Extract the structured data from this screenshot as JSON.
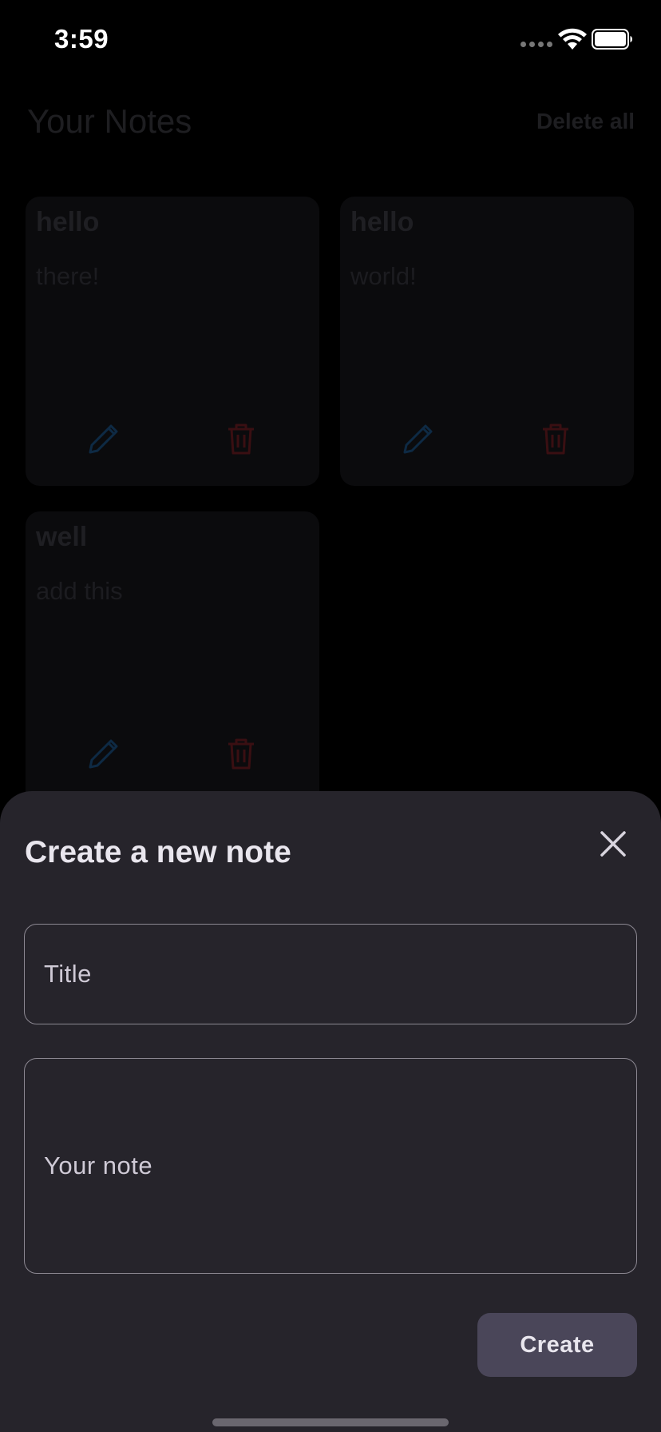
{
  "status_bar": {
    "time": "3:59"
  },
  "header": {
    "title": "Your Notes",
    "delete_all_label": "Delete all"
  },
  "notes": [
    {
      "title": "hello",
      "body": "there!"
    },
    {
      "title": "hello",
      "body": "world!"
    },
    {
      "title": "well",
      "body": "add this"
    }
  ],
  "sheet": {
    "title": "Create a new note",
    "title_placeholder": "Title",
    "note_placeholder": "Your note",
    "create_label": "Create"
  },
  "colors": {
    "sheet_background": "#26242b",
    "button_background": "#4a4659",
    "edit_icon": "#0e2a44",
    "delete_icon": "#3a0f12"
  },
  "icons": [
    "signal-icon",
    "wifi-icon",
    "battery-icon",
    "pencil-icon",
    "trash-icon",
    "close-icon"
  ]
}
